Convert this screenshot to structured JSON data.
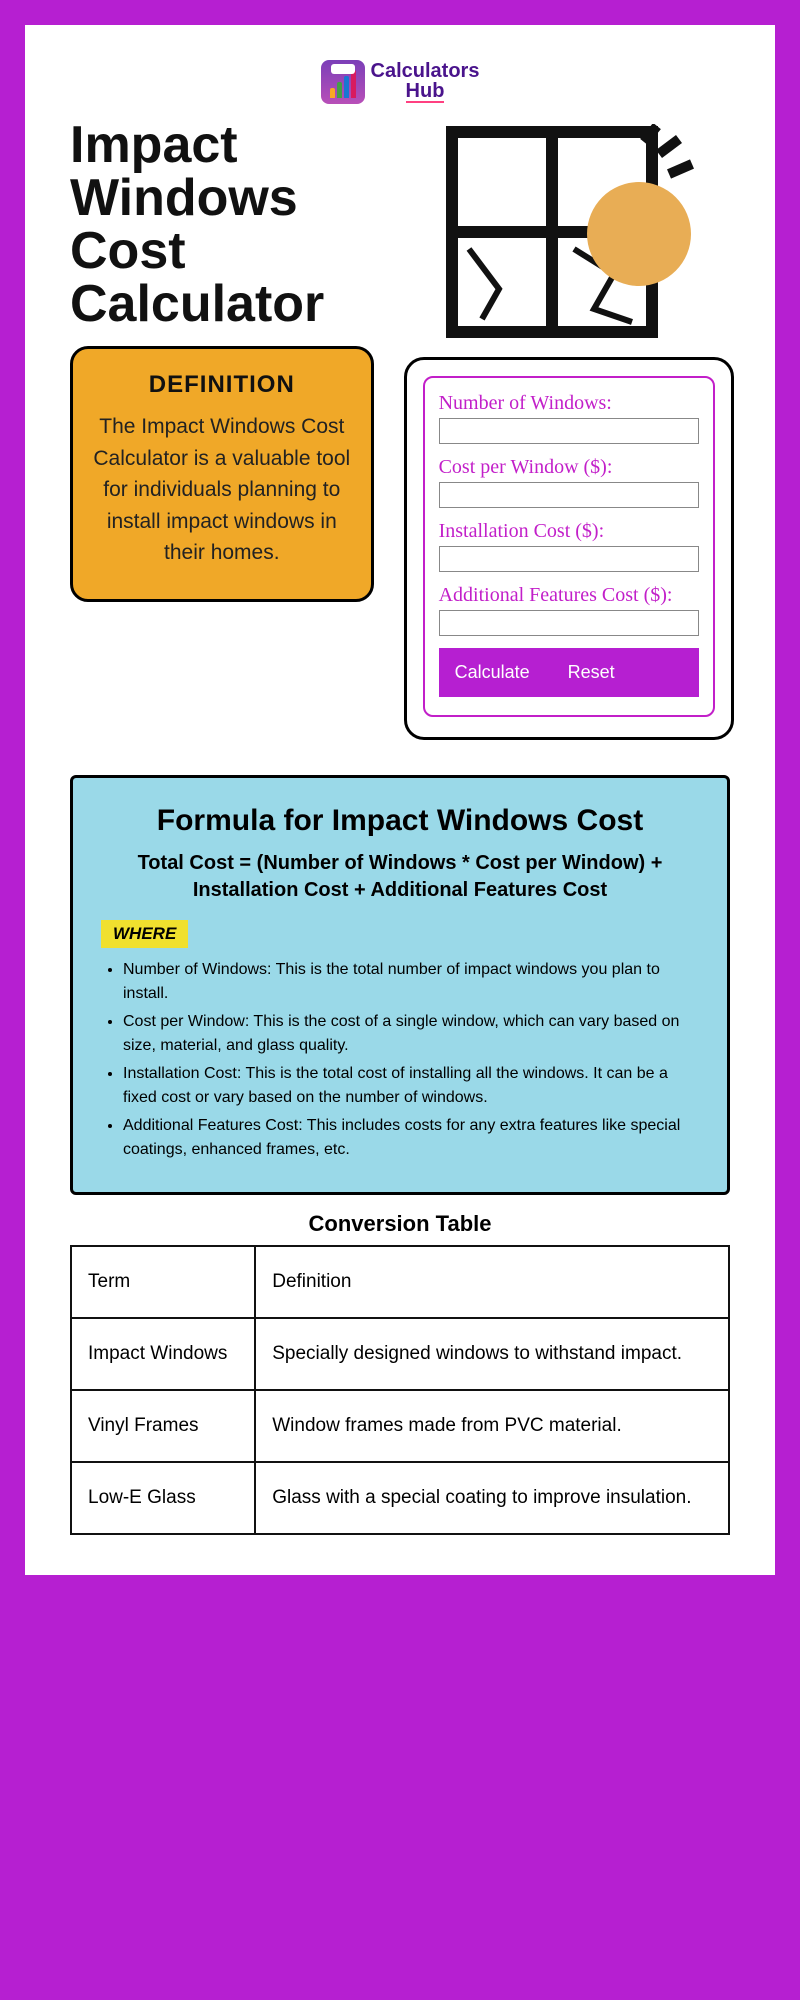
{
  "logo": {
    "line1": "Calculators",
    "line2": "Hub"
  },
  "title": "Impact Windows Cost Calculator",
  "definition": {
    "heading": "DEFINITION",
    "body": "The Impact Windows Cost Calculator is a valuable tool for individuals planning to install impact windows in their homes."
  },
  "form": {
    "fields": {
      "num_windows": "Number of Windows:",
      "cost_per_window": "Cost per Window ($):",
      "installation": "Installation Cost ($):",
      "additional": "Additional Features Cost ($):"
    },
    "buttons": {
      "calculate": "Calculate",
      "reset": "Reset"
    }
  },
  "formula": {
    "heading": "Formula for Impact Windows Cost",
    "equation": "Total Cost = (Number of Windows * Cost per Window) + Installation Cost + Additional Features Cost",
    "where": "WHERE",
    "items": [
      "Number of Windows: This is the total number of impact windows you plan to install.",
      "Cost per Window: This is the cost of a single window, which can vary based on size, material, and glass quality.",
      "Installation Cost: This is the total cost of installing all the windows. It can be a fixed cost or vary based on the number of windows.",
      "Additional Features Cost: This includes costs for any extra features like special coatings, enhanced frames, etc."
    ]
  },
  "table": {
    "title": "Conversion Table",
    "rows": [
      {
        "term": "Term",
        "def": "Definition"
      },
      {
        "term": "Impact Windows",
        "def": "Specially designed windows to withstand impact."
      },
      {
        "term": "Vinyl Frames",
        "def": "Window frames made from PVC material."
      },
      {
        "term": "Low-E Glass",
        "def": "Glass with a special coating to improve insulation."
      }
    ]
  }
}
